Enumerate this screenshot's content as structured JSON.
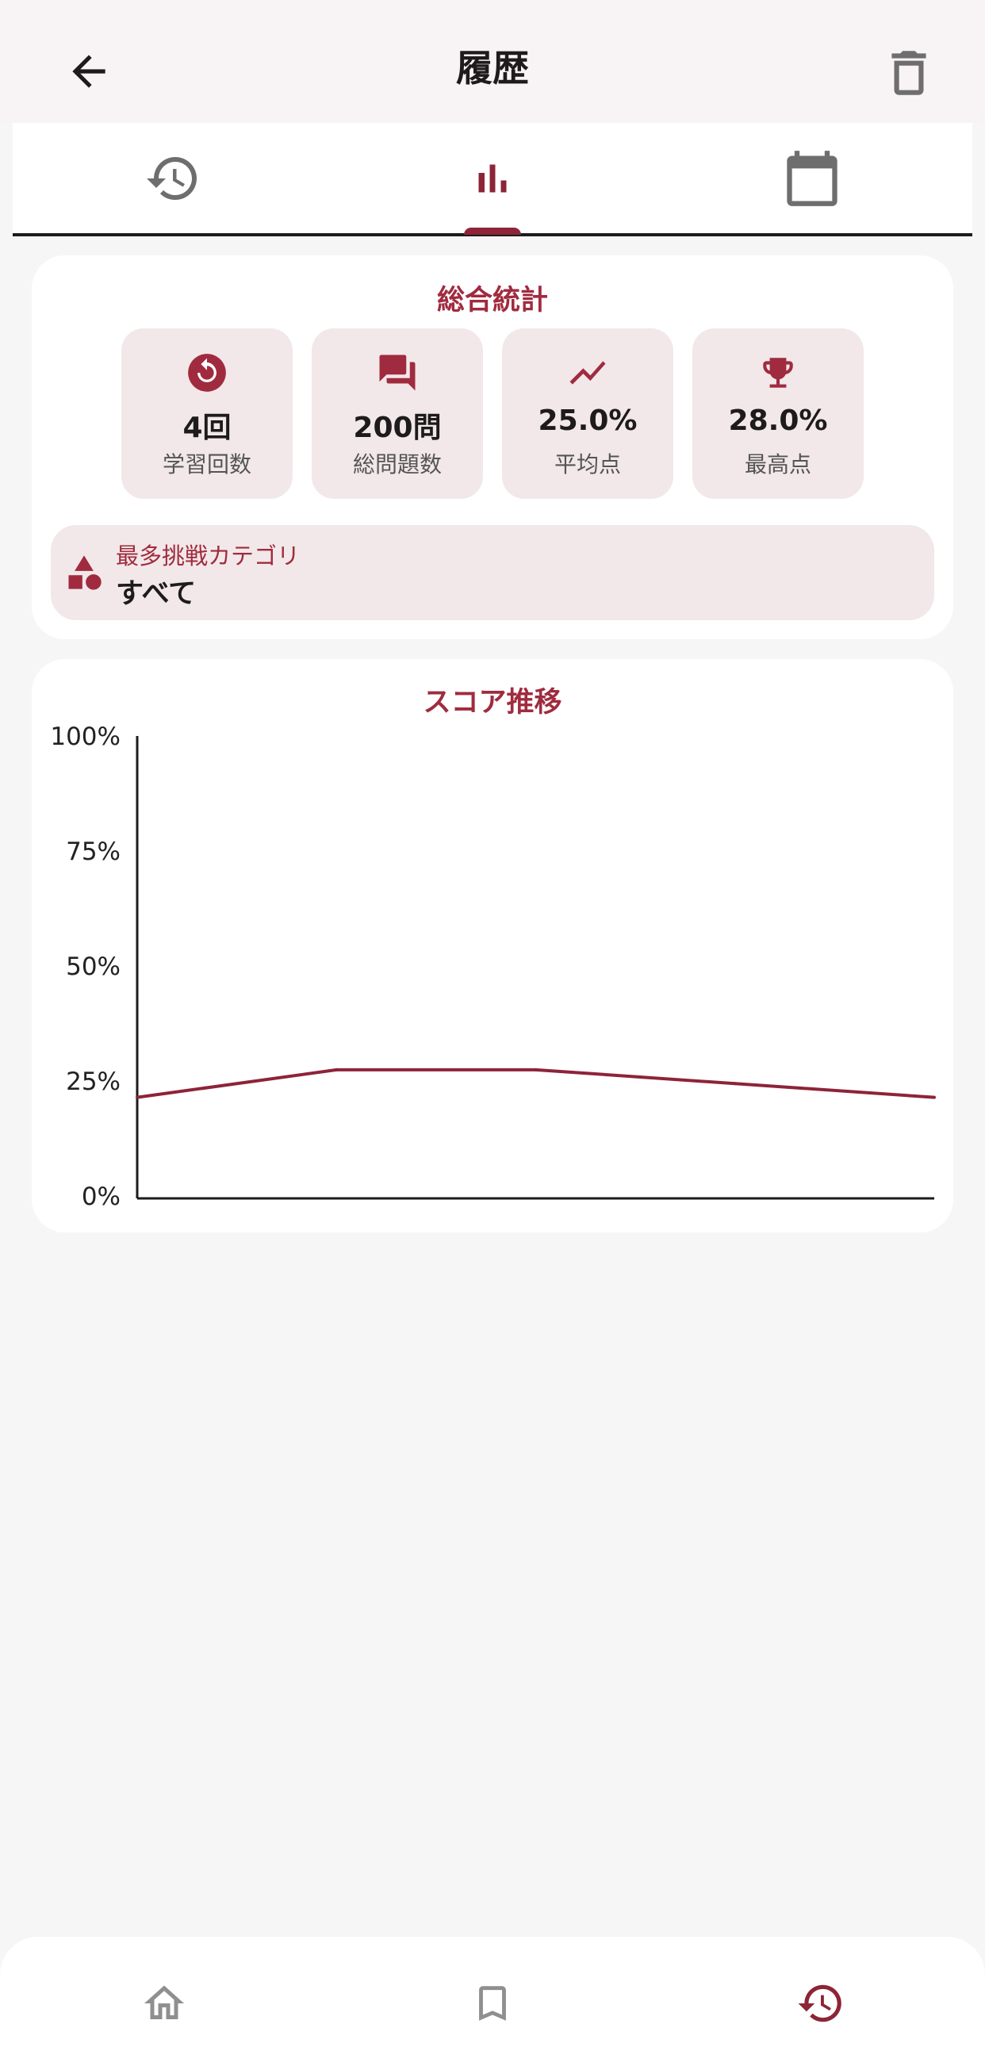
{
  "header": {
    "title": "履歴",
    "back_icon": "arrow-back-icon",
    "delete_icon": "trash-icon"
  },
  "tabs": [
    {
      "icon": "history-icon",
      "selected": false
    },
    {
      "icon": "bar-chart-icon",
      "selected": true
    },
    {
      "icon": "calendar-icon",
      "selected": false
    }
  ],
  "summary": {
    "title": "総合統計",
    "stats": [
      {
        "icon": "replay-icon",
        "value": "4回",
        "label": "学習回数"
      },
      {
        "icon": "chat-icon",
        "value": "200問",
        "label": "総問題数"
      },
      {
        "icon": "trending-icon",
        "value": "25.0%",
        "label": "平均点"
      },
      {
        "icon": "trophy-icon",
        "value": "28.0%",
        "label": "最高点"
      }
    ],
    "top_category": {
      "icon": "category-icon",
      "label": "最多挑戦カテゴリ",
      "value": "すべて"
    }
  },
  "chart_data": {
    "type": "line",
    "title": "スコア推移",
    "y_tick_labels": [
      "100%",
      "75%",
      "50%",
      "25%",
      "0%"
    ],
    "ylim": [
      0,
      100
    ],
    "x": [
      0,
      1,
      2,
      3,
      4
    ],
    "series": [
      {
        "values": [
          22,
          28,
          28,
          25,
          22
        ]
      }
    ],
    "grid": false,
    "colors": {
      "line": "#8d2437",
      "axis": "#1d1b1c"
    }
  },
  "bottom_nav": [
    {
      "icon": "home-icon",
      "selected": false
    },
    {
      "icon": "bookmark-icon",
      "selected": false
    },
    {
      "icon": "history-icon",
      "selected": true
    }
  ],
  "colors": {
    "accent": "#8d2437",
    "accent_text": "#a02b3f",
    "card_fill": "#f2e8e9",
    "inactive_icon": "#6e6e6e"
  }
}
